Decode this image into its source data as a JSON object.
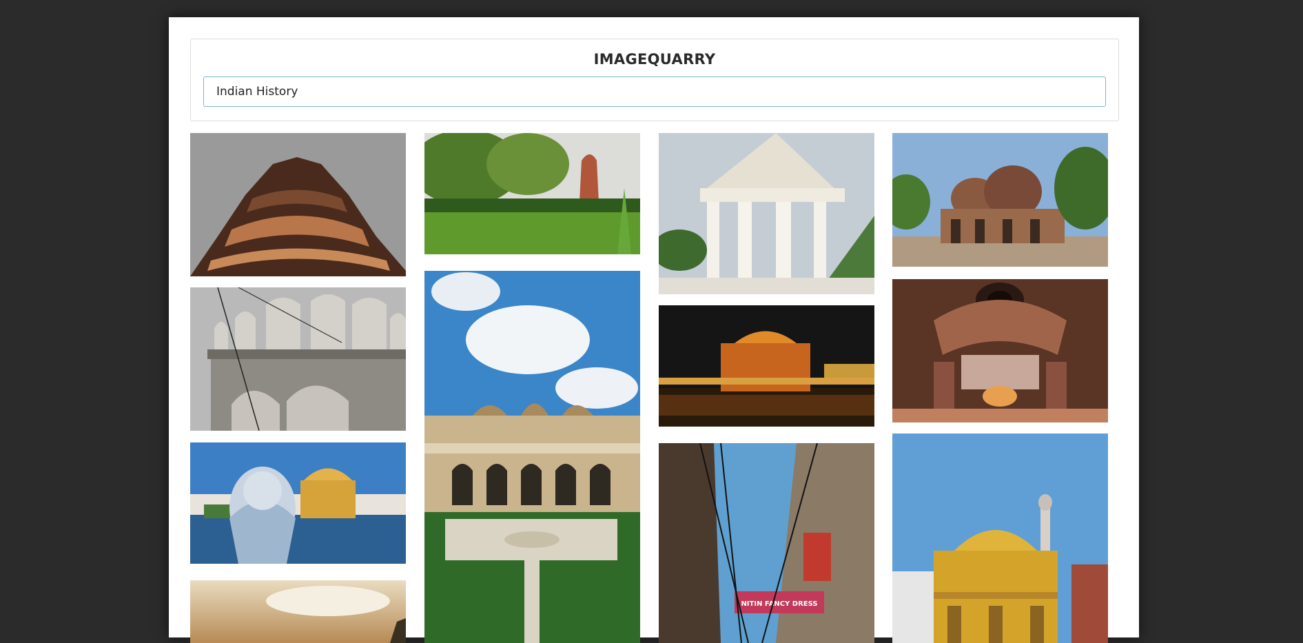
{
  "app": {
    "title": "IMAGEQUARRY"
  },
  "search": {
    "value": "Indian History",
    "placeholder": ""
  },
  "gallery": {
    "images": [
      {
        "name": "temple-spire-closeup"
      },
      {
        "name": "tower-in-park"
      },
      {
        "name": "white-marble-pavilion"
      },
      {
        "name": "domed-tomb-ruins"
      },
      {
        "name": "crenellated-fort-wall"
      },
      {
        "name": "palace-garden-under-clouds"
      },
      {
        "name": "golden-temple-at-night"
      },
      {
        "name": "carved-temple-ceiling"
      },
      {
        "name": "woman-viewing-golden-temple"
      },
      {
        "name": "old-city-street-with-wires"
      },
      {
        "name": "golden-temple-daylight"
      },
      {
        "name": "sunset-sky"
      }
    ]
  },
  "street_sign": {
    "text": "NITIN FANCY DRESS"
  }
}
